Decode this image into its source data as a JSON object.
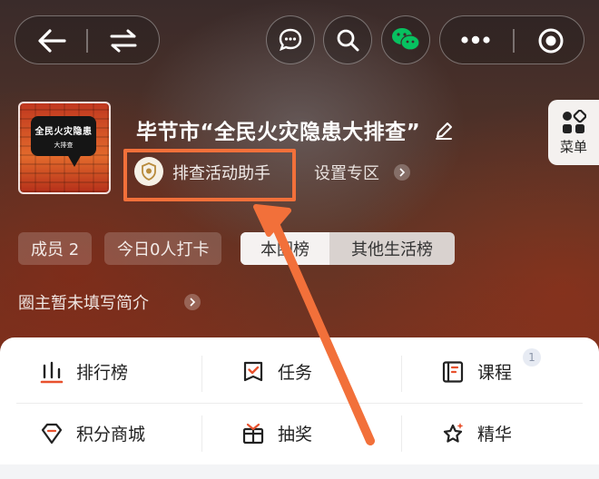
{
  "topbar": {
    "back_icon": "arrow-left-icon",
    "switch_icon": "swap-arrows-icon",
    "chat_icon": "chat-bubble-icon",
    "search_icon": "search-icon",
    "wechat_icon": "wechat-icon",
    "more_icon": "more-dots-icon",
    "close_icon": "target-close-icon"
  },
  "side_menu": {
    "label": "菜单",
    "icon": "grid-icon"
  },
  "cover": {
    "line1": "全民火灾隐患",
    "line2": "大排查"
  },
  "group": {
    "title": "毕节市“全民火灾隐患大排查”",
    "assistant": "排查活动助手",
    "settings": "设置专区"
  },
  "chips": {
    "members": "成员 2",
    "checkin": "今日0人打卡",
    "tab_active": "本圈榜",
    "tab_other": "其他生活榜"
  },
  "intro": "圈主暂未填写简介",
  "functions": [
    {
      "label": "排行榜",
      "icon": "bar-chart-icon"
    },
    {
      "label": "任务",
      "icon": "task-check-icon"
    },
    {
      "label": "课程",
      "icon": "course-book-icon",
      "badge": "1"
    },
    {
      "label": "积分商城",
      "icon": "diamond-icon"
    },
    {
      "label": "抽奖",
      "icon": "gift-icon"
    },
    {
      "label": "精华",
      "icon": "star-icon"
    }
  ],
  "colors": {
    "highlight": "#f2703a",
    "accent_red": "#e8512d"
  }
}
